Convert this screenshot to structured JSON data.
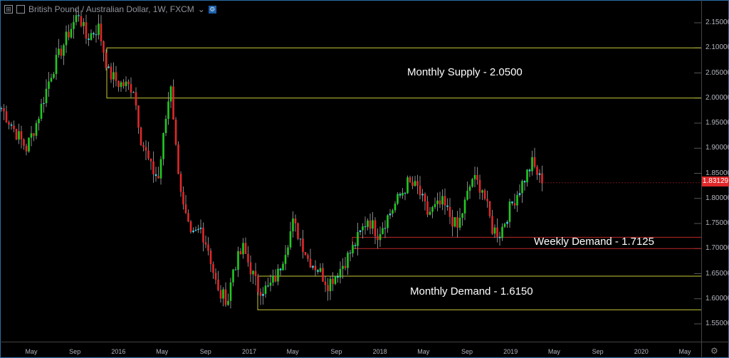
{
  "header": {
    "title": "British Pound / Australian Dollar, 1W, FXCM",
    "dropdown": "⌄",
    "expand_icon": "⊞"
  },
  "annotations": {
    "monthly_supply": "Monthly Supply - 2.0500",
    "weekly_demand": "Weekly Demand - 1.7125",
    "monthly_demand": "Monthly Demand - 1.6150"
  },
  "last_price": "1.83129",
  "colors": {
    "up": "#22c922",
    "down": "#e0282a",
    "doji": "#3fd6f0",
    "zone_yellow": "#c8c83a",
    "zone_red": "#c02828"
  },
  "chart_data": {
    "type": "candlestick",
    "title": "British Pound / Australian Dollar, 1W, FXCM",
    "y_ticks": [
      "2.15000",
      "2.10000",
      "2.05000",
      "2.00000",
      "1.95000",
      "1.90000",
      "1.85000",
      "1.80000",
      "1.75000",
      "1.70000",
      "1.65000",
      "1.60000",
      "1.55000"
    ],
    "ylim": [
      1.53,
      2.19
    ],
    "x_ticks": [
      "May",
      "Sep",
      "2016",
      "May",
      "Sep",
      "2017",
      "May",
      "Sep",
      "2018",
      "May",
      "Sep",
      "2019",
      "May",
      "Sep",
      "2020",
      "May"
    ],
    "price_path_weeks": [
      0,
      6,
      10,
      14,
      20,
      27,
      31,
      34,
      39,
      43,
      47,
      53,
      56,
      60,
      63,
      66,
      68,
      70,
      73,
      76,
      80,
      83,
      87,
      91,
      93,
      97,
      100,
      103,
      107,
      111,
      117,
      120,
      123,
      127,
      131,
      136,
      141,
      147,
      151,
      157,
      163,
      167,
      171,
      177,
      183,
      189,
      193,
      197,
      200,
      204,
      209,
      213,
      217
    ],
    "price_path_values": [
      1.98,
      1.93,
      1.9,
      1.95,
      2.05,
      2.13,
      2.17,
      2.12,
      2.14,
      2.05,
      2.03,
      2.02,
      1.92,
      1.86,
      1.84,
      1.96,
      2.03,
      1.9,
      1.78,
      1.72,
      1.74,
      1.7,
      1.61,
      1.6,
      1.66,
      1.7,
      1.66,
      1.62,
      1.62,
      1.65,
      1.75,
      1.72,
      1.68,
      1.66,
      1.63,
      1.66,
      1.7,
      1.76,
      1.73,
      1.78,
      1.83,
      1.82,
      1.77,
      1.79,
      1.74,
      1.84,
      1.82,
      1.74,
      1.73,
      1.78,
      1.83,
      1.87,
      1.83
    ],
    "zones": [
      {
        "name": "monthly supply",
        "from": 2.0,
        "to": 2.1,
        "color": "yellow"
      },
      {
        "name": "weekly demand",
        "from": 1.7,
        "to": 1.7225,
        "color": "red"
      },
      {
        "name": "monthly demand",
        "from": 1.578,
        "to": 1.645,
        "color": "yellow"
      }
    ]
  }
}
